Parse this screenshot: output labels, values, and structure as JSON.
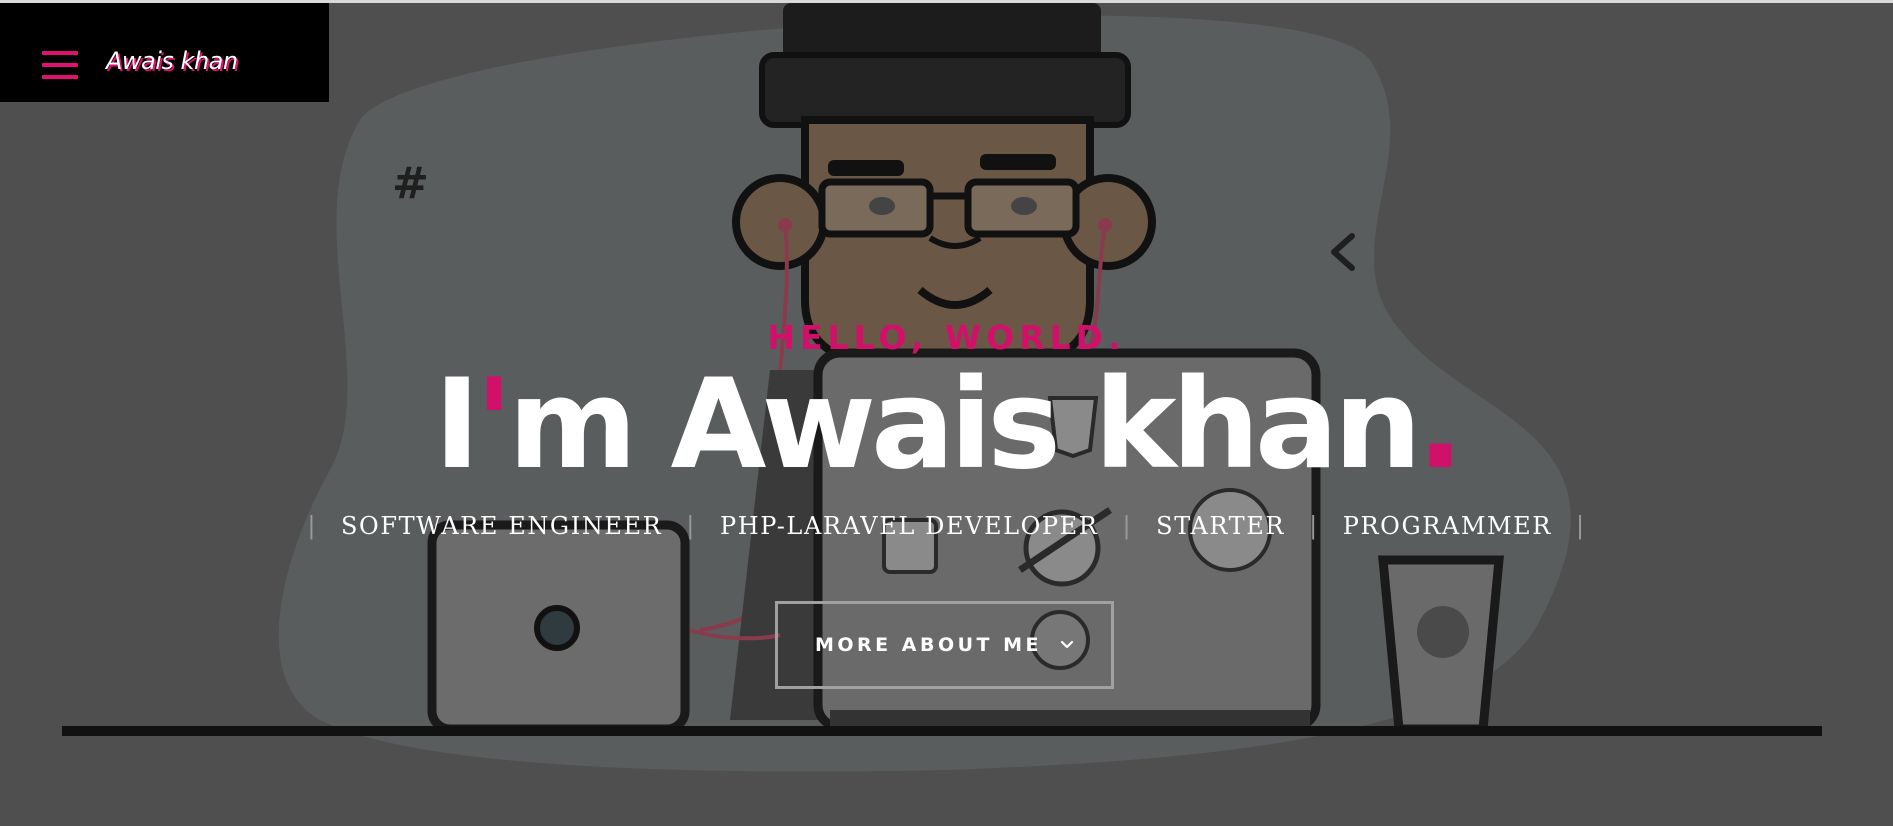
{
  "brand": {
    "name": "Awais khan"
  },
  "hero": {
    "kicker": "HELLO, WORLD.",
    "headline_pre": "I",
    "headline_apos": "'",
    "headline_main": "m Awais khan",
    "headline_dot": ".",
    "roles": [
      "SOFTWARE ENGINEER",
      "PHP-LARAVEL DEVELOPER",
      "STARTER",
      "PROGRAMMER"
    ],
    "separator": "|",
    "cta_label": "MORE ABOUT ME"
  },
  "icons": {
    "menu": "hamburger-menu-icon",
    "cta": "chevron-down-icon"
  },
  "colors": {
    "accent": "#d11169",
    "background": "#4f4f4f",
    "nav_bg": "#000000"
  }
}
